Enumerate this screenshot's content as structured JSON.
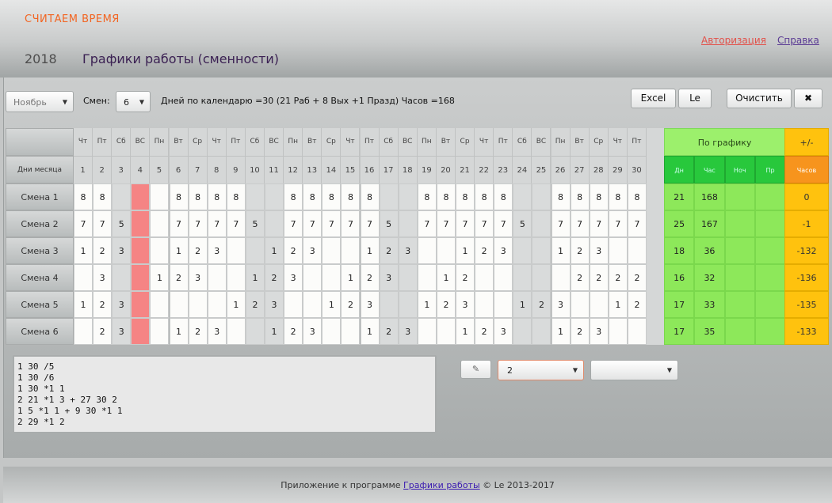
{
  "header": {
    "app_title": "СЧИТАЕМ ВРЕМЯ",
    "year": "2018",
    "page_title": "Графики работы (сменности)",
    "auth_link": "Авторизация",
    "help_link": "Справка"
  },
  "toolbar": {
    "month": "Ноябрь",
    "shifts_label": "Смен:",
    "shifts_value": "6",
    "summary": "Дней по календарю =30 (21 Раб + 8 Вых +1 Празд) Часов =168",
    "excel_label": "Excel",
    "le_label": "Le",
    "clear_label": "Очистить",
    "close_label": "✖"
  },
  "grid": {
    "days_label": "Дни месяца",
    "schedule_label": "По графику",
    "diff_label": "+/-",
    "summary_cols": [
      "Дн",
      "Час",
      "Ноч",
      "Пр"
    ],
    "diff_col": "Часов",
    "weekdays": [
      "Чт",
      "Пт",
      "Сб",
      "ВС",
      "Пн",
      "Вт",
      "Ср",
      "Чт",
      "Пт",
      "Сб",
      "ВС",
      "Пн",
      "Вт",
      "Ср",
      "Чт",
      "Пт",
      "Сб",
      "ВС",
      "Пн",
      "Вт",
      "Ср",
      "Чт",
      "Пт",
      "Сб",
      "ВС",
      "Пн",
      "Вт",
      "Ср",
      "Чт",
      "Пт"
    ],
    "days": [
      "1",
      "2",
      "3",
      "4",
      "5",
      "6",
      "7",
      "8",
      "9",
      "10",
      "11",
      "12",
      "13",
      "14",
      "15",
      "16",
      "17",
      "18",
      "19",
      "20",
      "21",
      "22",
      "23",
      "24",
      "25",
      "26",
      "27",
      "28",
      "29",
      "30"
    ],
    "rows": [
      {
        "label": "Смена 1",
        "cells": [
          "8",
          "8",
          "",
          "",
          "",
          "8",
          "8",
          "8",
          "8",
          "",
          "",
          "8",
          "8",
          "8",
          "8",
          "8",
          "",
          "",
          "8",
          "8",
          "8",
          "8",
          "8",
          "",
          "",
          "8",
          "8",
          "8",
          "8",
          "8"
        ],
        "days": "21",
        "hours": "168",
        "night": "",
        "hol": "",
        "diff": "0"
      },
      {
        "label": "Смена 2",
        "cells": [
          "7",
          "7",
          "5",
          "",
          "",
          "7",
          "7",
          "7",
          "7",
          "5",
          "",
          "7",
          "7",
          "7",
          "7",
          "7",
          "5",
          "",
          "7",
          "7",
          "7",
          "7",
          "7",
          "5",
          "",
          "7",
          "7",
          "7",
          "7",
          "7"
        ],
        "days": "25",
        "hours": "167",
        "night": "",
        "hol": "",
        "diff": "-1"
      },
      {
        "label": "Смена 3",
        "cells": [
          "1",
          "2",
          "3",
          "",
          "",
          "1",
          "2",
          "3",
          "",
          "",
          "1",
          "2",
          "3",
          "",
          "",
          "1",
          "2",
          "3",
          "",
          "",
          "1",
          "2",
          "3",
          "",
          "",
          "1",
          "2",
          "3",
          "",
          ""
        ],
        "days": "18",
        "hours": "36",
        "night": "",
        "hol": "",
        "diff": "-132"
      },
      {
        "label": "Смена 4",
        "cells": [
          "",
          "3",
          "",
          "",
          "1",
          "2",
          "3",
          "",
          "",
          "1",
          "2",
          "3",
          "",
          "",
          "1",
          "2",
          "3",
          "",
          "",
          "1",
          "2",
          "",
          "",
          "",
          "",
          "",
          "2",
          "2",
          "2",
          "2"
        ],
        "days": "16",
        "hours": "32",
        "night": "",
        "hol": "",
        "diff": "-136"
      },
      {
        "label": "Смена 5",
        "cells": [
          "1",
          "2",
          "3",
          "",
          "",
          "",
          "",
          "",
          "1",
          "2",
          "3",
          "",
          "",
          "1",
          "2",
          "3",
          "",
          "",
          "1",
          "2",
          "3",
          "",
          "",
          "1",
          "2",
          "3",
          "",
          "",
          "1",
          "2"
        ],
        "days": "17",
        "hours": "33",
        "night": "",
        "hol": "",
        "diff": "-135"
      },
      {
        "label": "Смена 6",
        "cells": [
          "",
          "2",
          "3",
          "",
          "",
          "1",
          "2",
          "3",
          "",
          "",
          "1",
          "2",
          "3",
          "",
          "",
          "1",
          "2",
          "3",
          "",
          "",
          "1",
          "2",
          "3",
          "",
          "",
          "1",
          "2",
          "3",
          "",
          ""
        ],
        "days": "17",
        "hours": "35",
        "night": "",
        "hol": "",
        "diff": "-133"
      }
    ]
  },
  "editor": {
    "text": "1 30 /5\n1 30 /6\n1 30 *1 1\n2 21 *1 3 + 27 30 2\n1 5 *1 1 + 9 30 *1 1\n2 29 *1 2",
    "pencil_icon": "✎",
    "select_value": "2",
    "select2_value": ""
  },
  "footer": {
    "prefix": "Приложение к программе",
    "link": "Графики работы",
    "suffix": "© Le 2013-2017"
  }
}
